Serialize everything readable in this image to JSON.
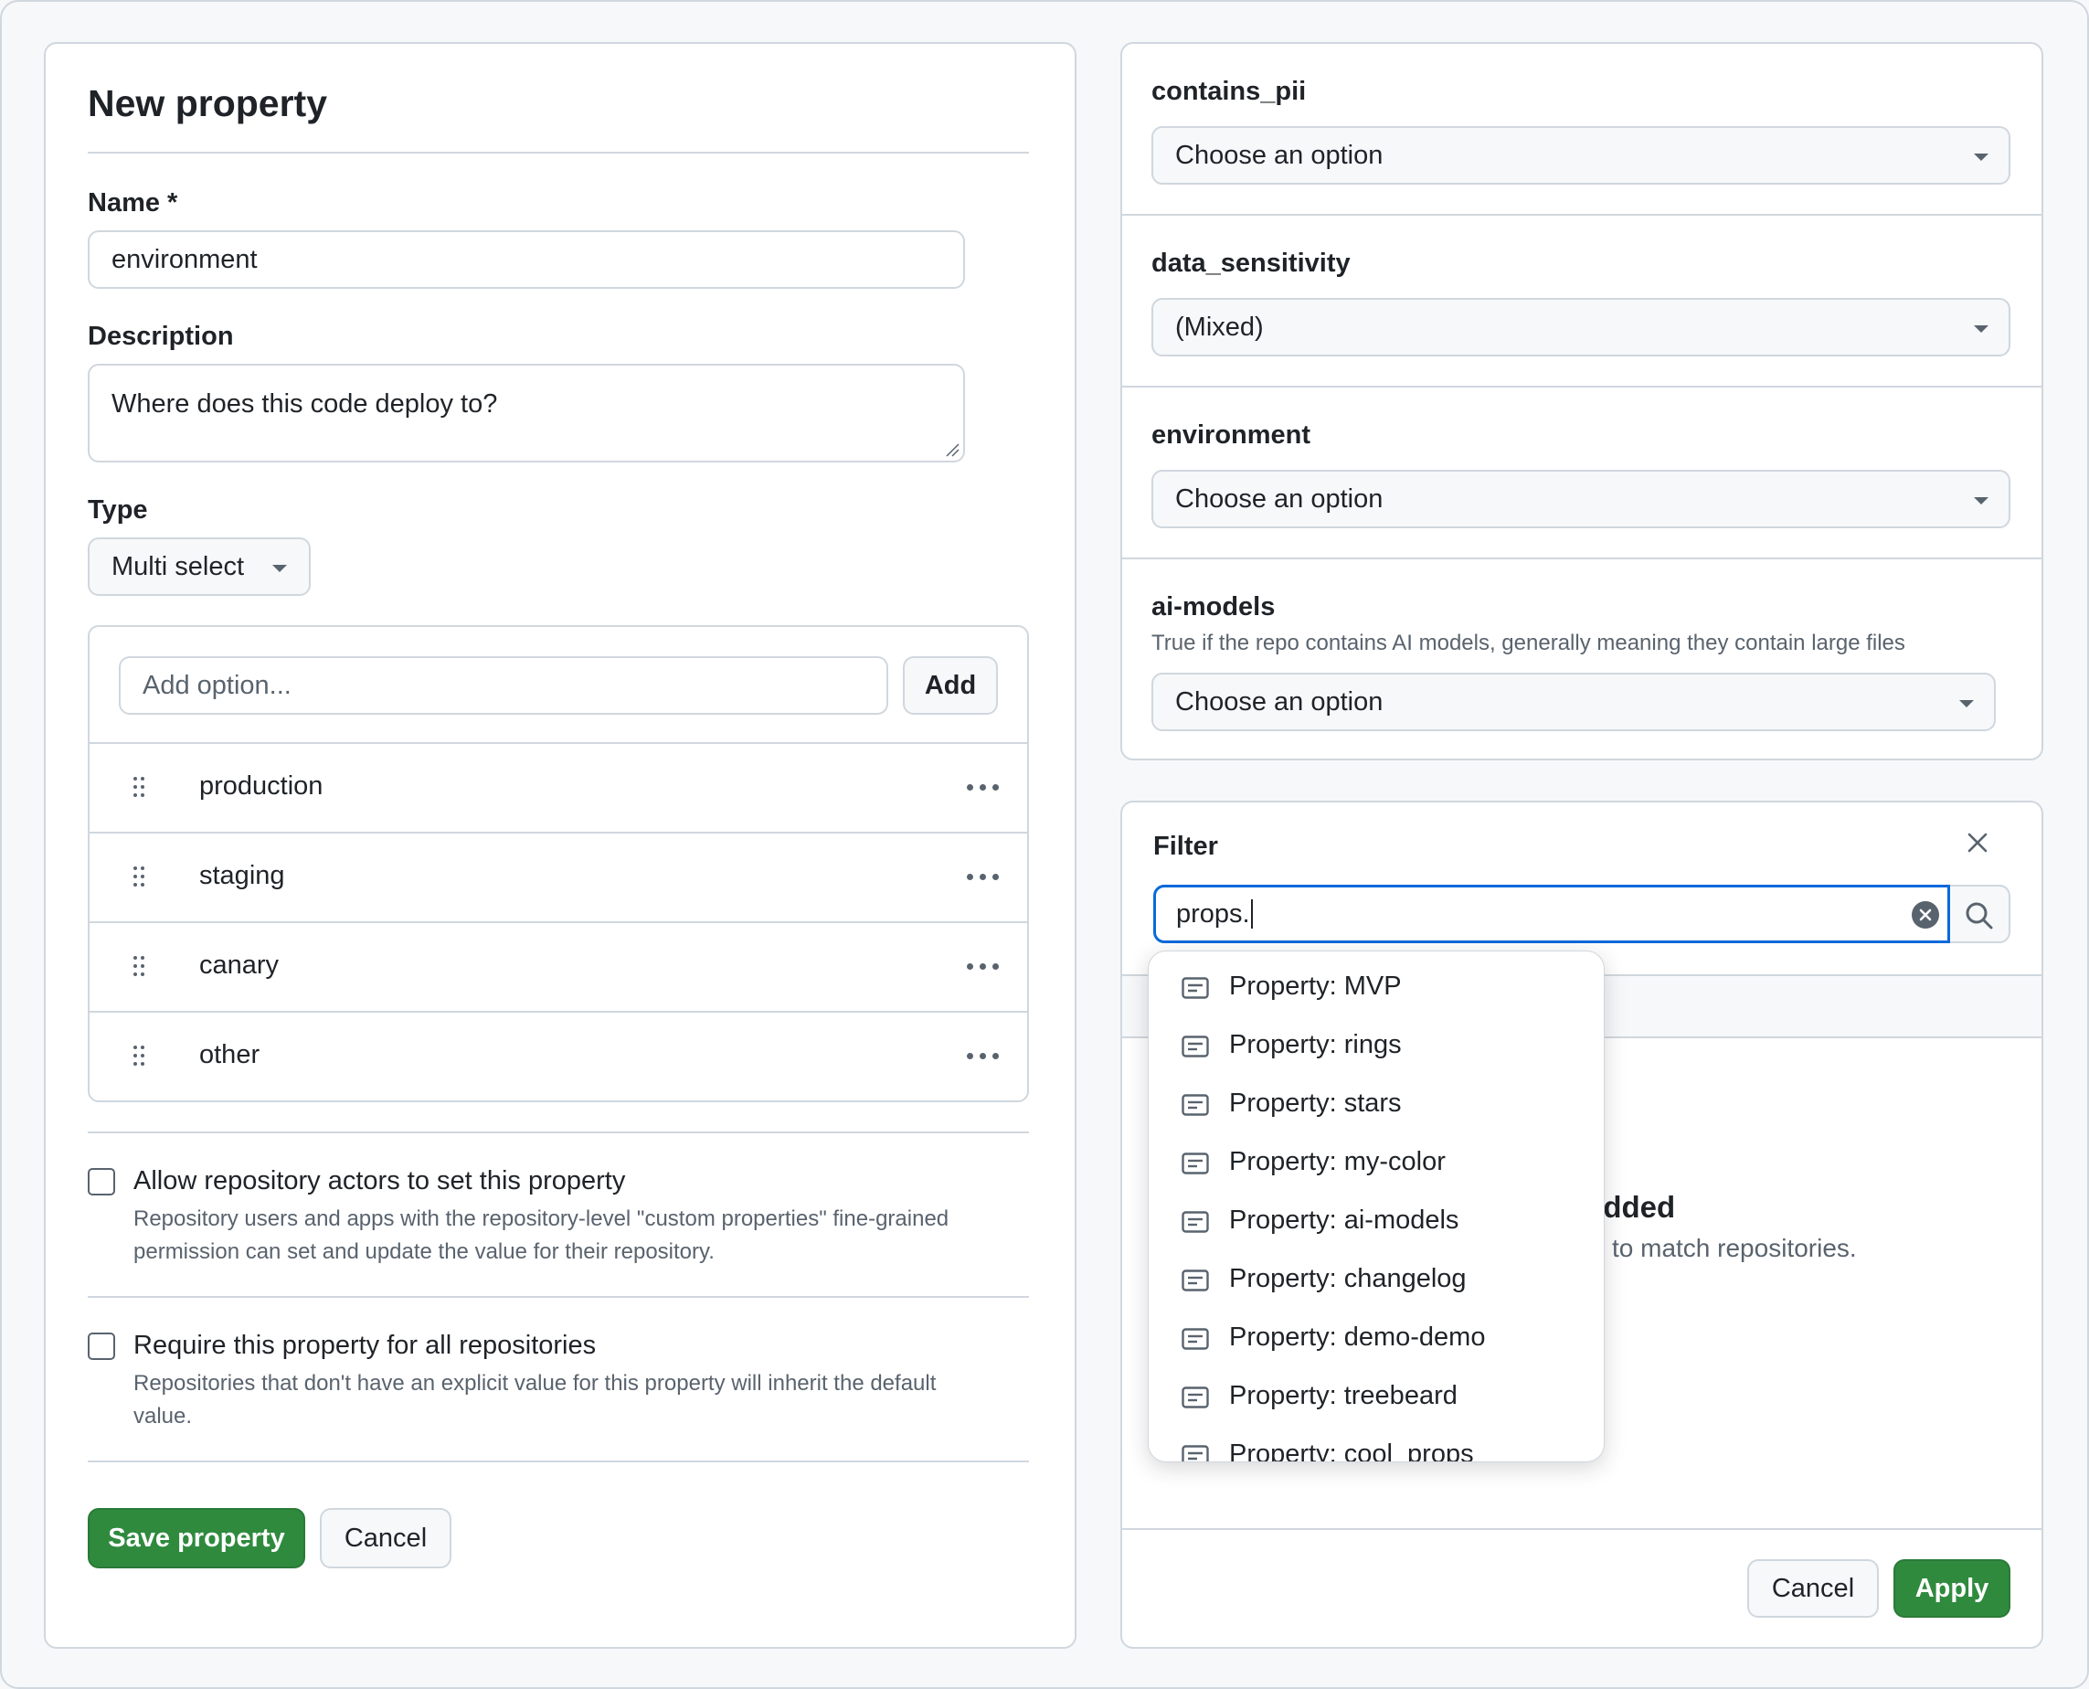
{
  "new_property": {
    "title": "New property",
    "name_label": "Name *",
    "name_value": "environment",
    "description_label": "Description",
    "description_value": "Where does this code deploy to?",
    "type_label": "Type",
    "type_value": "Multi select",
    "add_option_placeholder": "Add option...",
    "add_button": "Add",
    "options": [
      "production",
      "staging",
      "canary",
      "other"
    ],
    "allow_actors": {
      "label": "Allow repository actors to set this property",
      "help_line1": "Repository users and apps with the repository-level \"custom properties\" fine-grained",
      "help_line2": "permission can set and update the value for their repository.",
      "checked": false
    },
    "require": {
      "label": "Require this property for all repositories",
      "help_line1": "Repositories that don't have an explicit value for this property will inherit the default",
      "help_line2": "value.",
      "checked": false
    },
    "save_button": "Save property",
    "cancel_button": "Cancel"
  },
  "properties": [
    {
      "name": "contains_pii",
      "value": "Choose an option"
    },
    {
      "name": "data_sensitivity",
      "value": "(Mixed)"
    },
    {
      "name": "environment",
      "value": "Choose an option"
    },
    {
      "name": "ai-models",
      "description": "True if the repo contains AI models, generally meaning they contain large files",
      "value": "Choose an option"
    }
  ],
  "filter": {
    "title": "Filter",
    "query": "props.",
    "empty_heading_partial": "added",
    "empty_text_partial": "to match repositories.",
    "cancel_button": "Cancel",
    "apply_button": "Apply",
    "suggestions": [
      "Property: MVP",
      "Property: rings",
      "Property: stars",
      "Property: my-color",
      "Property: ai-models",
      "Property: changelog",
      "Property: demo-demo",
      "Property: treebeard",
      "Property: cool_props"
    ]
  },
  "icons": {
    "suggestion": "note-icon",
    "clear": "x-circle-fill-icon",
    "search": "search-icon",
    "close": "x-icon",
    "drag": "grabber-icon",
    "more": "kebab-horizontal-icon"
  },
  "colors": {
    "primary_button": "#2f8a3e",
    "focus_border": "#0969da",
    "border": "#d0d7de",
    "page_bg": "#f6f8fa"
  }
}
